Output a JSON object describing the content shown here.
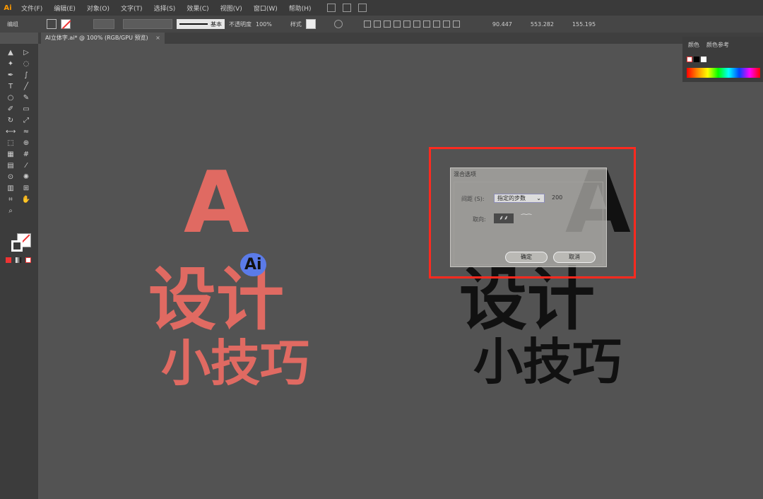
{
  "app": {
    "logo": "Ai"
  },
  "menu": {
    "items": [
      "文件(F)",
      "编辑(E)",
      "对象(O)",
      "文字(T)",
      "选择(S)",
      "效果(C)",
      "视图(V)",
      "窗口(W)",
      "帮助(H)"
    ]
  },
  "controlbar": {
    "state_label": "编组",
    "stroke_style": "基本",
    "opacity_label": "不透明度",
    "opacity_value": "100%",
    "style_label": "样式",
    "x_value": "90.447",
    "y_value": "553.282",
    "w_value": "155.195"
  },
  "document_tab": {
    "label": "AI立体字.ai* @ 100% (RGB/GPU 预览)",
    "close": "×"
  },
  "panel": {
    "tabs": [
      "颜色",
      "颜色参考"
    ]
  },
  "artwork": {
    "left": {
      "title": "A",
      "line1": "设计",
      "line2": "小技巧",
      "color": "#e06a62",
      "center": "Ai"
    },
    "right": {
      "title": "A",
      "line1": "设计",
      "line2": "小技巧",
      "color": "#111111"
    }
  },
  "dialog": {
    "title": "混合选项",
    "spacing_label": "间距 (S):",
    "spacing_option": "指定的步数",
    "spacing_value": "200",
    "orientation_label": "取向:",
    "ok_label": "确定",
    "cancel_label": "取消",
    "highlight_color": "#ff2a1f"
  }
}
